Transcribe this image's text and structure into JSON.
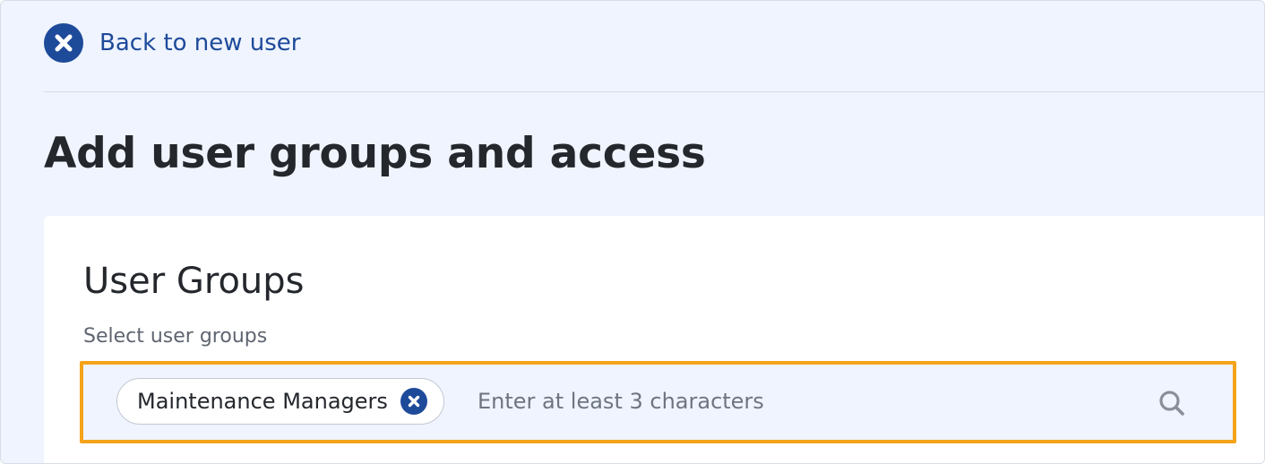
{
  "nav": {
    "back_label": "Back to new user",
    "back_icon": "close-circle-icon"
  },
  "page": {
    "title": "Add user groups and access"
  },
  "user_groups": {
    "section_title": "User Groups",
    "field_label": "Select user groups",
    "selected": [
      {
        "label": "Maintenance Managers",
        "remove_icon": "close-circle-icon"
      }
    ],
    "search": {
      "value": "",
      "placeholder": "Enter at least 3 characters",
      "icon": "search-icon"
    }
  },
  "colors": {
    "accent_blue": "#1e4a9a",
    "focus_border": "#f5a31a",
    "page_background": "#eff4fe",
    "card_background": "#ffffff",
    "title_text": "#24272c",
    "muted_text": "#5f6570"
  }
}
